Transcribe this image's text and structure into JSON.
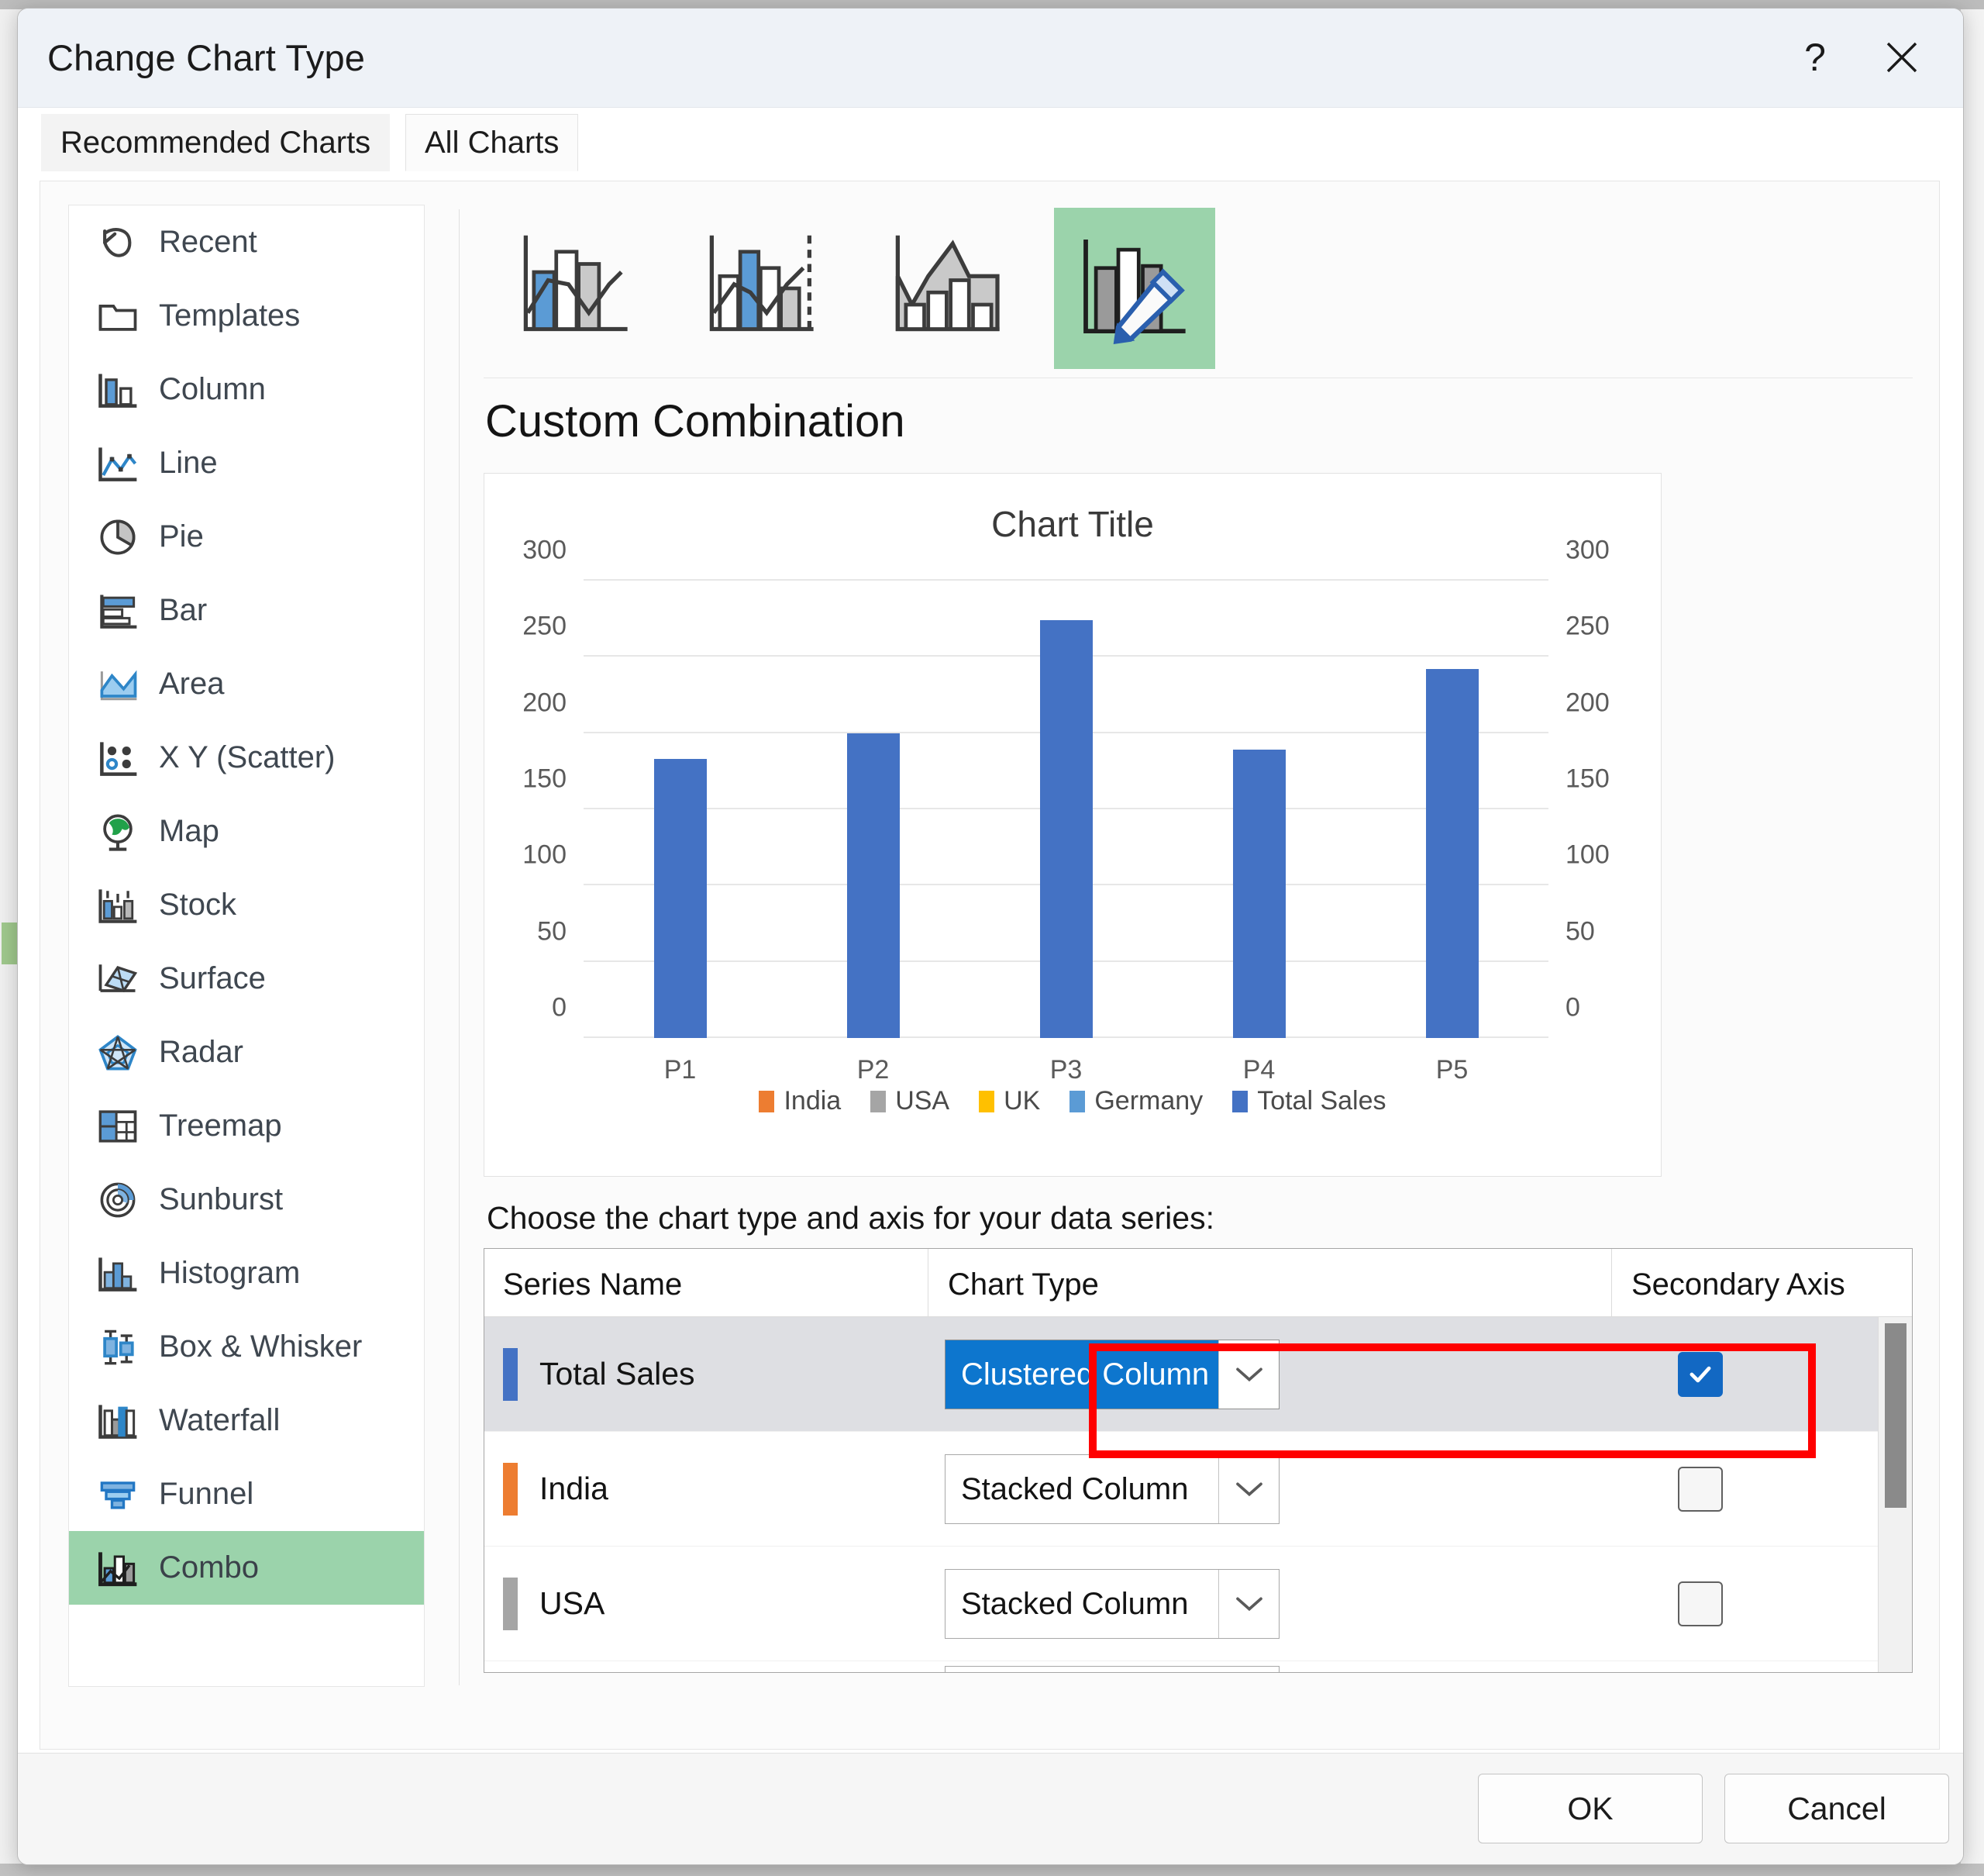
{
  "window": {
    "title": "Change Chart Type",
    "help_label": "?",
    "close_label": "✕"
  },
  "tabs": [
    {
      "label": "Recommended Charts",
      "active": false
    },
    {
      "label": "All Charts",
      "active": true
    }
  ],
  "sidebar": {
    "items": [
      {
        "label": "Recent",
        "icon": "recent-icon",
        "selected": false
      },
      {
        "label": "Templates",
        "icon": "templates-folder-icon",
        "selected": false
      },
      {
        "label": "Column",
        "icon": "column-chart-icon",
        "selected": false
      },
      {
        "label": "Line",
        "icon": "line-chart-icon",
        "selected": false
      },
      {
        "label": "Pie",
        "icon": "pie-chart-icon",
        "selected": false
      },
      {
        "label": "Bar",
        "icon": "bar-chart-icon",
        "selected": false
      },
      {
        "label": "Area",
        "icon": "area-chart-icon",
        "selected": false
      },
      {
        "label": "X Y (Scatter)",
        "icon": "scatter-chart-icon",
        "selected": false
      },
      {
        "label": "Map",
        "icon": "map-globe-icon",
        "selected": false
      },
      {
        "label": "Stock",
        "icon": "stock-chart-icon",
        "selected": false
      },
      {
        "label": "Surface",
        "icon": "surface-chart-icon",
        "selected": false
      },
      {
        "label": "Radar",
        "icon": "radar-chart-icon",
        "selected": false
      },
      {
        "label": "Treemap",
        "icon": "treemap-chart-icon",
        "selected": false
      },
      {
        "label": "Sunburst",
        "icon": "sunburst-chart-icon",
        "selected": false
      },
      {
        "label": "Histogram",
        "icon": "histogram-chart-icon",
        "selected": false
      },
      {
        "label": "Box & Whisker",
        "icon": "box-whisker-chart-icon",
        "selected": false
      },
      {
        "label": "Waterfall",
        "icon": "waterfall-chart-icon",
        "selected": false
      },
      {
        "label": "Funnel",
        "icon": "funnel-chart-icon",
        "selected": false
      },
      {
        "label": "Combo",
        "icon": "combo-chart-icon",
        "selected": true
      }
    ]
  },
  "thumbnails": [
    {
      "name": "clustered-column-line",
      "selected": false
    },
    {
      "name": "clustered-column-line-on-secondary-axis",
      "selected": false
    },
    {
      "name": "stacked-area-clustered-column",
      "selected": false
    },
    {
      "name": "custom-combination",
      "selected": true
    }
  ],
  "combo_heading": "Custom Combination",
  "series_prompt": "Choose the chart type and axis for your data series:",
  "table": {
    "headers": [
      "Series Name",
      "Chart Type",
      "Secondary Axis"
    ],
    "rows": [
      {
        "series": "Total Sales",
        "swatch": "#4472c4",
        "chart_type": "Clustered Column",
        "secondary_axis": true,
        "selected": true,
        "focused": true
      },
      {
        "series": "India",
        "swatch": "#ed7d31",
        "chart_type": "Stacked Column",
        "secondary_axis": false,
        "selected": false,
        "focused": false
      },
      {
        "series": "USA",
        "swatch": "#a5a5a5",
        "chart_type": "Stacked Column",
        "secondary_axis": false,
        "selected": false,
        "focused": false
      }
    ]
  },
  "footer": {
    "ok_label": "OK",
    "cancel_label": "Cancel"
  },
  "colors": {
    "accent_blue": "#4472c4",
    "selection_blue": "#0d76ce",
    "selected_green": "#9bd3ab",
    "annotation_red": "#ff0000",
    "row_selected_gray": "#dedfe3"
  },
  "chart_data": {
    "type": "bar",
    "title": "Chart Title",
    "xlabel": "",
    "ylabel": "",
    "categories": [
      "P1",
      "P2",
      "P3",
      "P4",
      "P5"
    ],
    "series": [
      {
        "name": "Total Sales",
        "color": "#4472c4",
        "values": [
          183,
          200,
          274,
          189,
          242
        ]
      }
    ],
    "ylim": [
      0,
      300
    ],
    "yticks": [
      0,
      50,
      100,
      150,
      200,
      250,
      300
    ],
    "secondary_ylim": [
      0,
      300
    ],
    "secondary_yticks": [
      0,
      50,
      100,
      150,
      200,
      250,
      300
    ],
    "grid": true,
    "legend_position": "bottom",
    "legend": [
      {
        "label": "India",
        "color": "#ed7d31"
      },
      {
        "label": "USA",
        "color": "#a5a5a5"
      },
      {
        "label": "UK",
        "color": "#ffc000"
      },
      {
        "label": "Germany",
        "color": "#5b9bd5"
      },
      {
        "label": "Total Sales",
        "color": "#4472c4"
      }
    ]
  }
}
